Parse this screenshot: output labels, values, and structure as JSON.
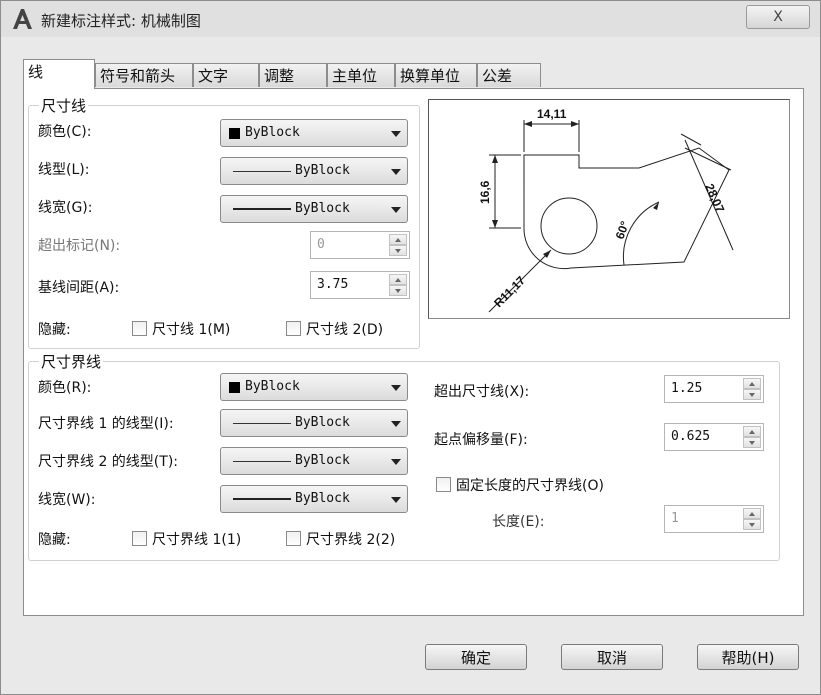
{
  "window": {
    "title": "新建标注样式: 机械制图",
    "close_label": "X"
  },
  "tabs": [
    {
      "label": "线"
    },
    {
      "label": "符号和箭头"
    },
    {
      "label": "文字"
    },
    {
      "label": "调整"
    },
    {
      "label": "主单位"
    },
    {
      "label": "换算单位"
    },
    {
      "label": "公差"
    }
  ],
  "dim_lines": {
    "title": "尺寸线",
    "color_label": "颜色(C):",
    "color_value": "ByBlock",
    "linetype_label": "线型(L):",
    "linetype_value": "ByBlock",
    "lineweight_label": "线宽(G):",
    "lineweight_value": "ByBlock",
    "extend_label": "超出标记(N):",
    "extend_value": "0",
    "baseline_label": "基线间距(A):",
    "baseline_value": "3.75",
    "suppress_label": "隐藏:",
    "suppress1_label": "尺寸线 1(M)",
    "suppress2_label": "尺寸线 2(D)"
  },
  "ext_lines": {
    "title": "尺寸界线",
    "color_label": "颜色(R):",
    "color_value": "ByBlock",
    "linetype1_label": "尺寸界线 1 的线型(I):",
    "linetype1_value": "ByBlock",
    "linetype2_label": "尺寸界线 2 的线型(T):",
    "linetype2_value": "ByBlock",
    "lineweight_label": "线宽(W):",
    "lineweight_value": "ByBlock",
    "suppress_label": "隐藏:",
    "suppress1_label": "尺寸界线 1(1)",
    "suppress2_label": "尺寸界线 2(2)",
    "extend_label": "超出尺寸线(X):",
    "extend_value": "1.25",
    "offset_label": "起点偏移量(F):",
    "offset_value": "0.625",
    "fixed_label": "固定长度的尺寸界线(O)",
    "length_label": "长度(E):",
    "length_value": "1"
  },
  "preview": {
    "dim_top": "14,11",
    "dim_left": "16,6",
    "dim_slant": "28,07",
    "angle": "60°",
    "radius": "R11,17"
  },
  "buttons": {
    "ok": "确定",
    "cancel": "取消",
    "help": "帮助(H)"
  }
}
